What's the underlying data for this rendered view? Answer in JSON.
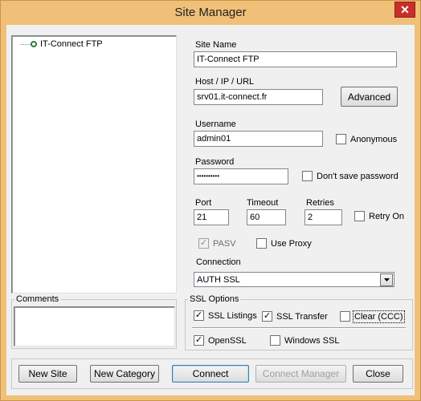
{
  "window": {
    "title": "Site Manager",
    "close_label": "✕"
  },
  "tree": {
    "items": [
      {
        "label": "IT-Connect FTP"
      }
    ]
  },
  "comments": {
    "group_label": "Comments",
    "value": ""
  },
  "form": {
    "site_name": {
      "label": "Site Name",
      "value": "IT-Connect FTP"
    },
    "host": {
      "label": "Host / IP / URL",
      "value": "srv01.it-connect.fr"
    },
    "advanced_button": "Advanced",
    "username": {
      "label": "Username",
      "value": "admin01"
    },
    "anonymous": {
      "label": "Anonymous",
      "checked": false
    },
    "password": {
      "label": "Password",
      "value": "••••••••••"
    },
    "dont_save_password": {
      "label": "Don't save password",
      "checked": false
    },
    "port": {
      "label": "Port",
      "value": "21"
    },
    "timeout": {
      "label": "Timeout",
      "value": "60"
    },
    "retries": {
      "label": "Retries",
      "value": "2"
    },
    "retry_on": {
      "label": "Retry On",
      "checked": false
    },
    "pasv": {
      "label": "PASV",
      "checked": true,
      "disabled": true
    },
    "use_proxy": {
      "label": "Use Proxy",
      "checked": false
    },
    "connection": {
      "label": "Connection",
      "value": "AUTH SSL"
    }
  },
  "ssl": {
    "group_label": "SSL Options",
    "ssl_listings": {
      "label": "SSL Listings",
      "checked": true
    },
    "ssl_transfer": {
      "label": "SSL Transfer",
      "checked": true
    },
    "clear_ccc": {
      "label": "Clear (CCC)",
      "checked": false
    },
    "openssl": {
      "label": "OpenSSL",
      "checked": true
    },
    "windows_ssl": {
      "label": "Windows SSL",
      "checked": false
    }
  },
  "buttons": {
    "new_site": "New Site",
    "new_category": "New Category",
    "connect": "Connect",
    "connect_manager": "Connect Manager",
    "close": "Close"
  },
  "colors": {
    "titlebar": "#f0c078",
    "close_button": "#c7302a",
    "tree_site_icon": "#2e7d32"
  }
}
